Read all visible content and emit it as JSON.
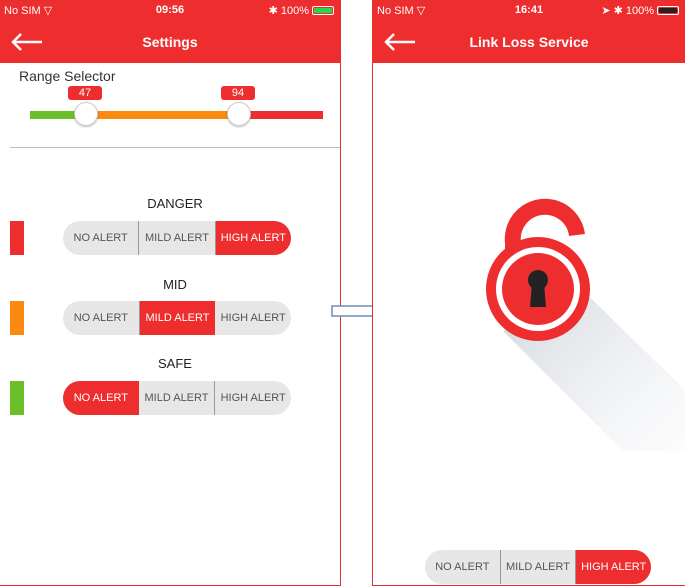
{
  "left_screen": {
    "status": {
      "carrier": "No SIM",
      "time": "09:56",
      "battery": "100%"
    },
    "nav": {
      "title": "Settings"
    },
    "range": {
      "label": "Range Selector",
      "low_value": "47",
      "high_value": "94",
      "colors": {
        "safe": "#6bbf2a",
        "mid": "#fb8a10",
        "danger": "#ee2e2e"
      }
    },
    "groups": [
      {
        "title": "DANGER",
        "color": "#ee2e2e",
        "options": [
          "NO ALERT",
          "MILD ALERT",
          "HIGH ALERT"
        ],
        "selected": "HIGH ALERT"
      },
      {
        "title": "MID",
        "color": "#fb8a10",
        "options": [
          "NO ALERT",
          "MILD ALERT",
          "HIGH ALERT"
        ],
        "selected": "MILD ALERT"
      },
      {
        "title": "SAFE",
        "color": "#6bbf2a",
        "options": [
          "NO ALERT",
          "MILD ALERT",
          "HIGH ALERT"
        ],
        "selected": "NO ALERT"
      }
    ]
  },
  "right_screen": {
    "status": {
      "carrier": "No SIM",
      "time": "16:41",
      "battery": "100%"
    },
    "nav": {
      "title": "Link Loss Service"
    },
    "lock_icon": "unlocked-padlock-icon",
    "alert": {
      "options": [
        "NO ALERT",
        "MILD ALERT",
        "HIGH ALERT"
      ],
      "selected": "HIGH ALERT"
    }
  },
  "accent_color": "#ee2e2e"
}
